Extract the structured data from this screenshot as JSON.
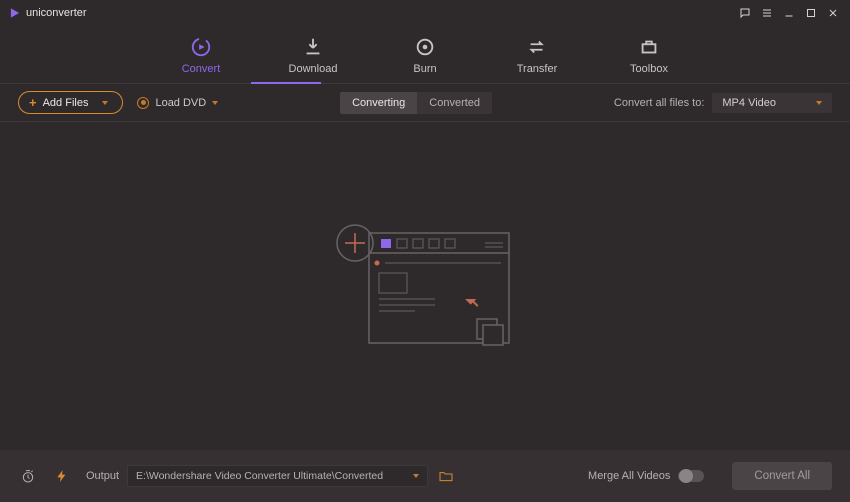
{
  "app": {
    "name": "uniconverter"
  },
  "nav": {
    "items": [
      {
        "label": "Convert"
      },
      {
        "label": "Download"
      },
      {
        "label": "Burn"
      },
      {
        "label": "Transfer"
      },
      {
        "label": "Toolbox"
      }
    ],
    "active_index": 0
  },
  "subbar": {
    "add_files_label": "Add Files",
    "load_dvd_label": "Load DVD",
    "seg": {
      "converting": "Converting",
      "converted": "Converted",
      "active": "converting"
    },
    "convert_all_to_label": "Convert all files to:",
    "format_selected": "MP4 Video"
  },
  "bottom": {
    "output_label": "Output",
    "output_path": "E:\\Wondershare Video Converter Ultimate\\Converted",
    "merge_label": "Merge All Videos",
    "convert_all_btn": "Convert All"
  }
}
